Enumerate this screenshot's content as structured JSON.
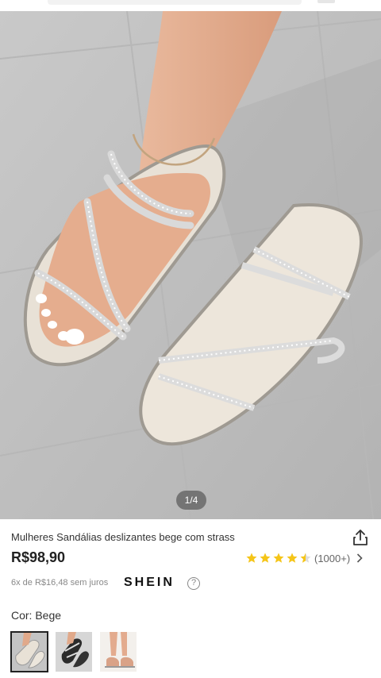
{
  "gallery": {
    "pager": "1/4"
  },
  "product": {
    "title": "Mulheres Sandálias deslizantes bege com strass",
    "price": "R$98,90",
    "rating_count": "(1000+)",
    "installments": "6x de R$16,48 sem juros",
    "brand": "SHEIN",
    "help_glyph": "?",
    "color_label": "Cor: Bege",
    "rating_value": 4.5
  },
  "colors": {
    "accent_star": "#f5c518",
    "text_primary": "#222222",
    "text_secondary": "#888888"
  },
  "icons": {
    "share": "share-icon",
    "star": "star-icon",
    "chevron": "chevron-right-icon",
    "help": "help-icon"
  }
}
